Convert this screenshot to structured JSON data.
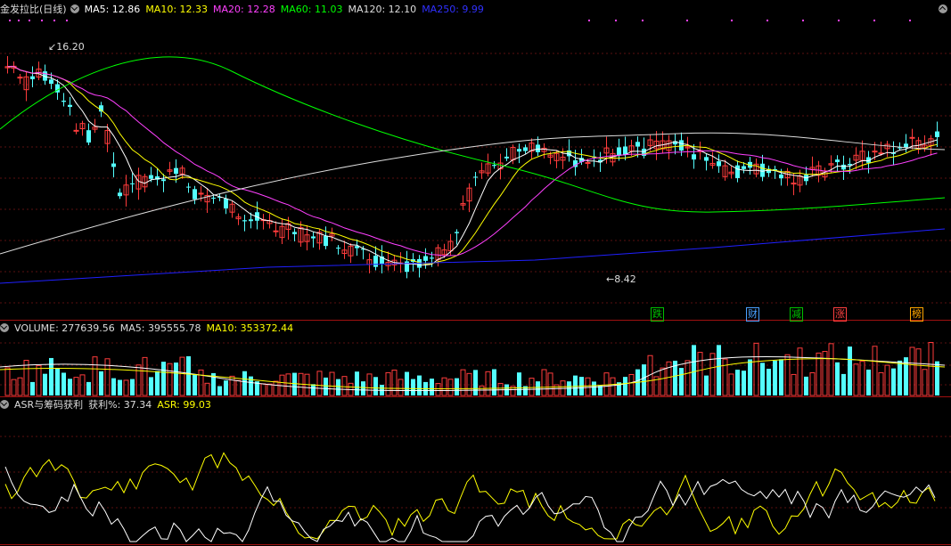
{
  "main_header": {
    "title": "金发拉比(日线)",
    "ma5": "MA5: 12.86",
    "ma10": "MA10: 12.33",
    "ma20": "MA20: 12.28",
    "ma60": "MA60: 11.03",
    "ma120": "MA120: 12.10",
    "ma250": "MA250: 9.99"
  },
  "annotations": {
    "high": "16.20",
    "low": "8.42"
  },
  "events": [
    {
      "label": "跌",
      "color": "#00c000"
    },
    {
      "label": "财",
      "color": "#4aa0ff"
    },
    {
      "label": "减",
      "color": "#00c000"
    },
    {
      "label": "涨",
      "color": "#ff4040"
    },
    {
      "label": "榜",
      "color": "#ffa500"
    }
  ],
  "volume_header": {
    "volume": "VOLUME: 277639.56",
    "ma5": "MA5: 395555.78",
    "ma10": "MA10: 353372.44"
  },
  "asr_header": {
    "title": "ASR与筹码获利",
    "profit": "获利%: 37.34",
    "asr": "ASR: 99.03"
  },
  "colors": {
    "up": "#ff3c3c",
    "down": "#54ffff",
    "ma5": "#ffffff",
    "ma10": "#ffff00",
    "ma20": "#ff40ff",
    "ma60": "#00ff00",
    "ma120": "#dddddd",
    "ma250": "#2020ff"
  },
  "icons": [
    "panel-collapse-icon",
    "expand-icon"
  ]
}
